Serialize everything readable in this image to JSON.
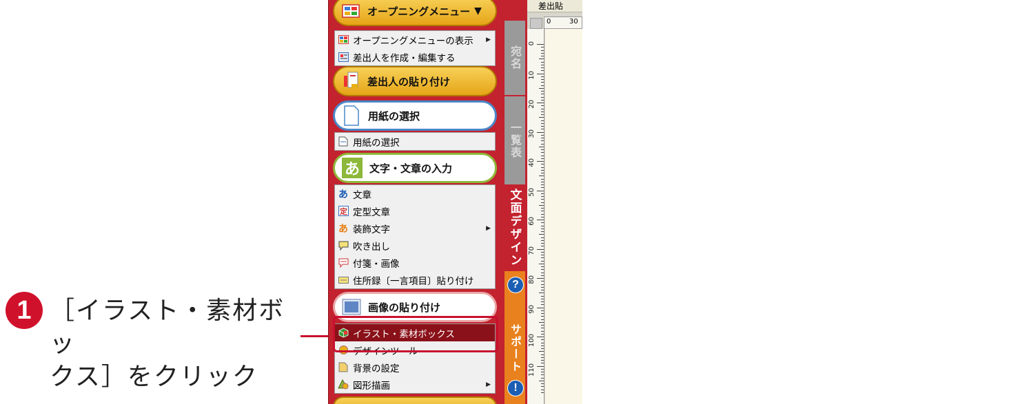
{
  "callout": {
    "step": "1",
    "line1": "［イラスト・素材ボッ",
    "line2": "クス］をクリック"
  },
  "menu": {
    "opening_button": "オープニングメニュー",
    "opening_items": [
      "オープニングメニューの表示",
      "差出人を作成・編集する"
    ],
    "sender_button": "差出人の貼り付け",
    "paper_button": "用紙の選択",
    "paper_items": [
      "用紙の選択"
    ],
    "text_button": "文字・文章の入力",
    "text_items": [
      "文章",
      "定型文章",
      "装飾文字",
      "吹き出し",
      "付箋・画像",
      "住所録〔一言項目〕貼り付け"
    ],
    "image_button": "画像の貼り付け",
    "image_items": [
      "イラスト・素材ボックス",
      "デザインツール",
      "背景の設定",
      "図形描画"
    ]
  },
  "tabs": {
    "address": "宛名",
    "list": "一覧表",
    "design": "文面デザイン",
    "support": "サポート",
    "help_icon": "?",
    "info_icon": "!"
  },
  "canvas": {
    "top_tab": "差出貼",
    "hruler_labels": [
      "0",
      "30"
    ],
    "vruler_labels": [
      "0",
      "10",
      "20",
      "30",
      "40",
      "50",
      "60",
      "70",
      "80",
      "90",
      "100",
      "110"
    ]
  },
  "colors": {
    "panel_red": "#c3222f",
    "highlight_red": "#c8102e",
    "selected_row": "#8a1119",
    "support_tab": "#e8811e"
  }
}
